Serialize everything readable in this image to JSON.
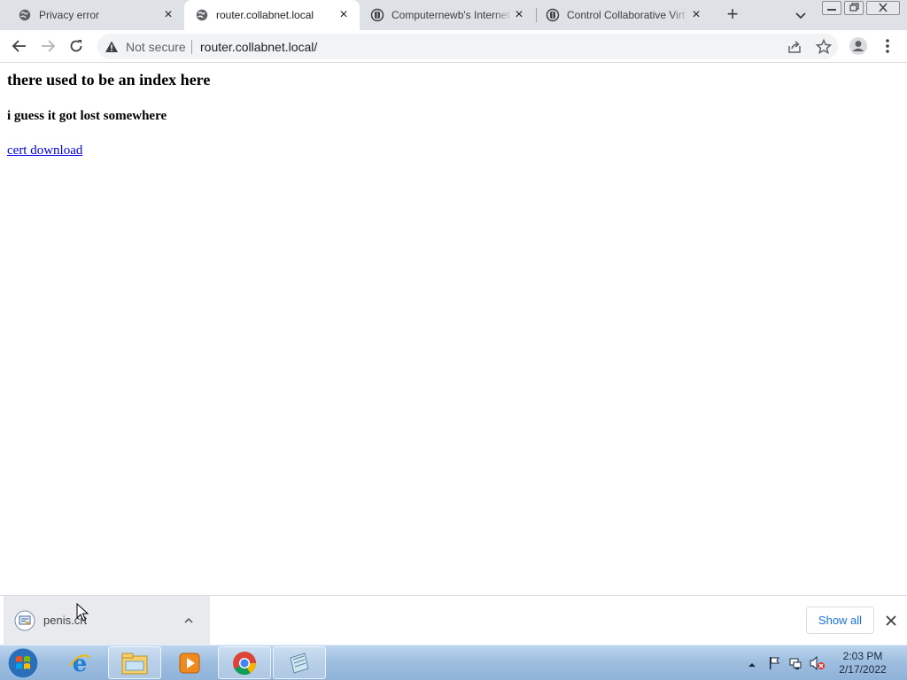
{
  "browser": {
    "tabs": [
      {
        "title": "Privacy error",
        "active": false,
        "favicon": "globe-icon"
      },
      {
        "title": "router.collabnet.local",
        "active": true,
        "favicon": "globe-icon"
      },
      {
        "title": "Computernewb's Internet",
        "active": false,
        "favicon": "collabvm-icon"
      },
      {
        "title": "Control Collaborative Virt",
        "active": false,
        "favicon": "collabvm-icon"
      }
    ],
    "tab_close_glyph": "×",
    "new_tab_glyph": "+",
    "address": {
      "security_label": "Not secure",
      "url": "router.collabnet.local/"
    }
  },
  "page": {
    "heading": "there used to be an index here",
    "subheading": "i guess it got lost somewhere",
    "link_text": "cert download"
  },
  "download_shelf": {
    "file_name": "penis.crt",
    "show_all_label": "Show all"
  },
  "taskbar": {
    "apps": [
      "internet-explorer-icon",
      "file-explorer-icon",
      "media-player-icon",
      "chrome-icon",
      "notes-icon"
    ],
    "clock_time": "2:03 PM",
    "clock_date": "2/17/2022"
  }
}
